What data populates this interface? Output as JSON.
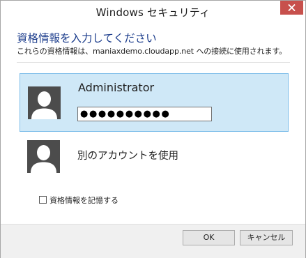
{
  "window": {
    "title": "Windows セキュリティ",
    "close_icon": "close-icon"
  },
  "prompt": {
    "heading": "資格情報を入力してください",
    "description": "これらの資格情報は、maniaxdemo.cloudapp.net への接続に使用されます。"
  },
  "selected_account": {
    "username": "Administrator",
    "password_masked": "●●●●●●●●●●",
    "avatar_icon": "user-avatar-icon"
  },
  "other_account": {
    "label": "別のアカウントを使用",
    "avatar_icon": "user-avatar-icon"
  },
  "remember": {
    "label": "資格情報を記憶する",
    "checked": false
  },
  "buttons": {
    "ok": "OK",
    "cancel": "キャンセル"
  },
  "colors": {
    "accent_heading": "#1c3d8c",
    "selected_bg": "#cfe8f7",
    "selected_border": "#7dbde9",
    "close_button": "#c7504c"
  }
}
